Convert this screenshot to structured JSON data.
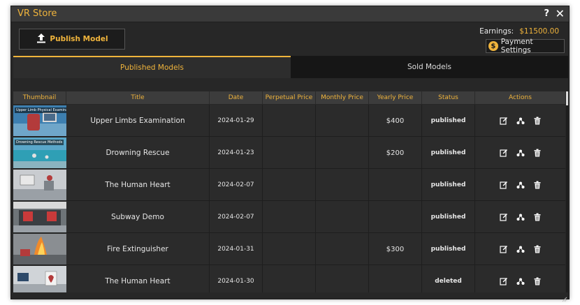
{
  "window": {
    "title": "VR Store",
    "help_label": "?",
    "close_label": "✕"
  },
  "toolbar": {
    "publish_label": "Publish Model"
  },
  "earnings": {
    "label": "Earnings:",
    "value": "$11500.00"
  },
  "payment": {
    "label": "Payment Settings",
    "coin_symbol": "$"
  },
  "tabs": [
    {
      "label": "Published Models",
      "active": true
    },
    {
      "label": "Sold Models",
      "active": false
    }
  ],
  "table": {
    "headers": [
      "Thumbnail",
      "Title",
      "Date",
      "Perpetual Price",
      "Monthly Price",
      "Yearly Price",
      "Status",
      "Actions"
    ],
    "rows": [
      {
        "thumb_label": "Upper Limb Physical Examination",
        "title": "Upper Limbs Examination",
        "date": "2024-01-29",
        "perpetual": "",
        "monthly": "",
        "yearly": "$400",
        "status": "published"
      },
      {
        "thumb_label": "Drowning Rescue Methods",
        "title": "Drowning Rescue",
        "date": "2024-01-23",
        "perpetual": "",
        "monthly": "",
        "yearly": "$200",
        "status": "published"
      },
      {
        "thumb_label": "",
        "title": "The Human Heart",
        "date": "2024-02-07",
        "perpetual": "",
        "monthly": "",
        "yearly": "",
        "status": "published"
      },
      {
        "thumb_label": "",
        "title": "Subway Demo",
        "date": "2024-02-07",
        "perpetual": "",
        "monthly": "",
        "yearly": "",
        "status": "published"
      },
      {
        "thumb_label": "",
        "title": "Fire Extinguisher",
        "date": "2024-01-31",
        "perpetual": "",
        "monthly": "",
        "yearly": "$300",
        "status": "published"
      },
      {
        "thumb_label": "",
        "title": "The Human Heart",
        "date": "2024-01-30",
        "perpetual": "",
        "monthly": "",
        "yearly": "",
        "status": "deleted"
      }
    ],
    "row_actions": [
      "edit-icon",
      "share-icon",
      "delete-icon"
    ]
  },
  "colors": {
    "accent": "#f0b43c",
    "window_bg": "#272727",
    "row_bg": "#2b2b2b",
    "header_bg": "#3c3c3c"
  }
}
